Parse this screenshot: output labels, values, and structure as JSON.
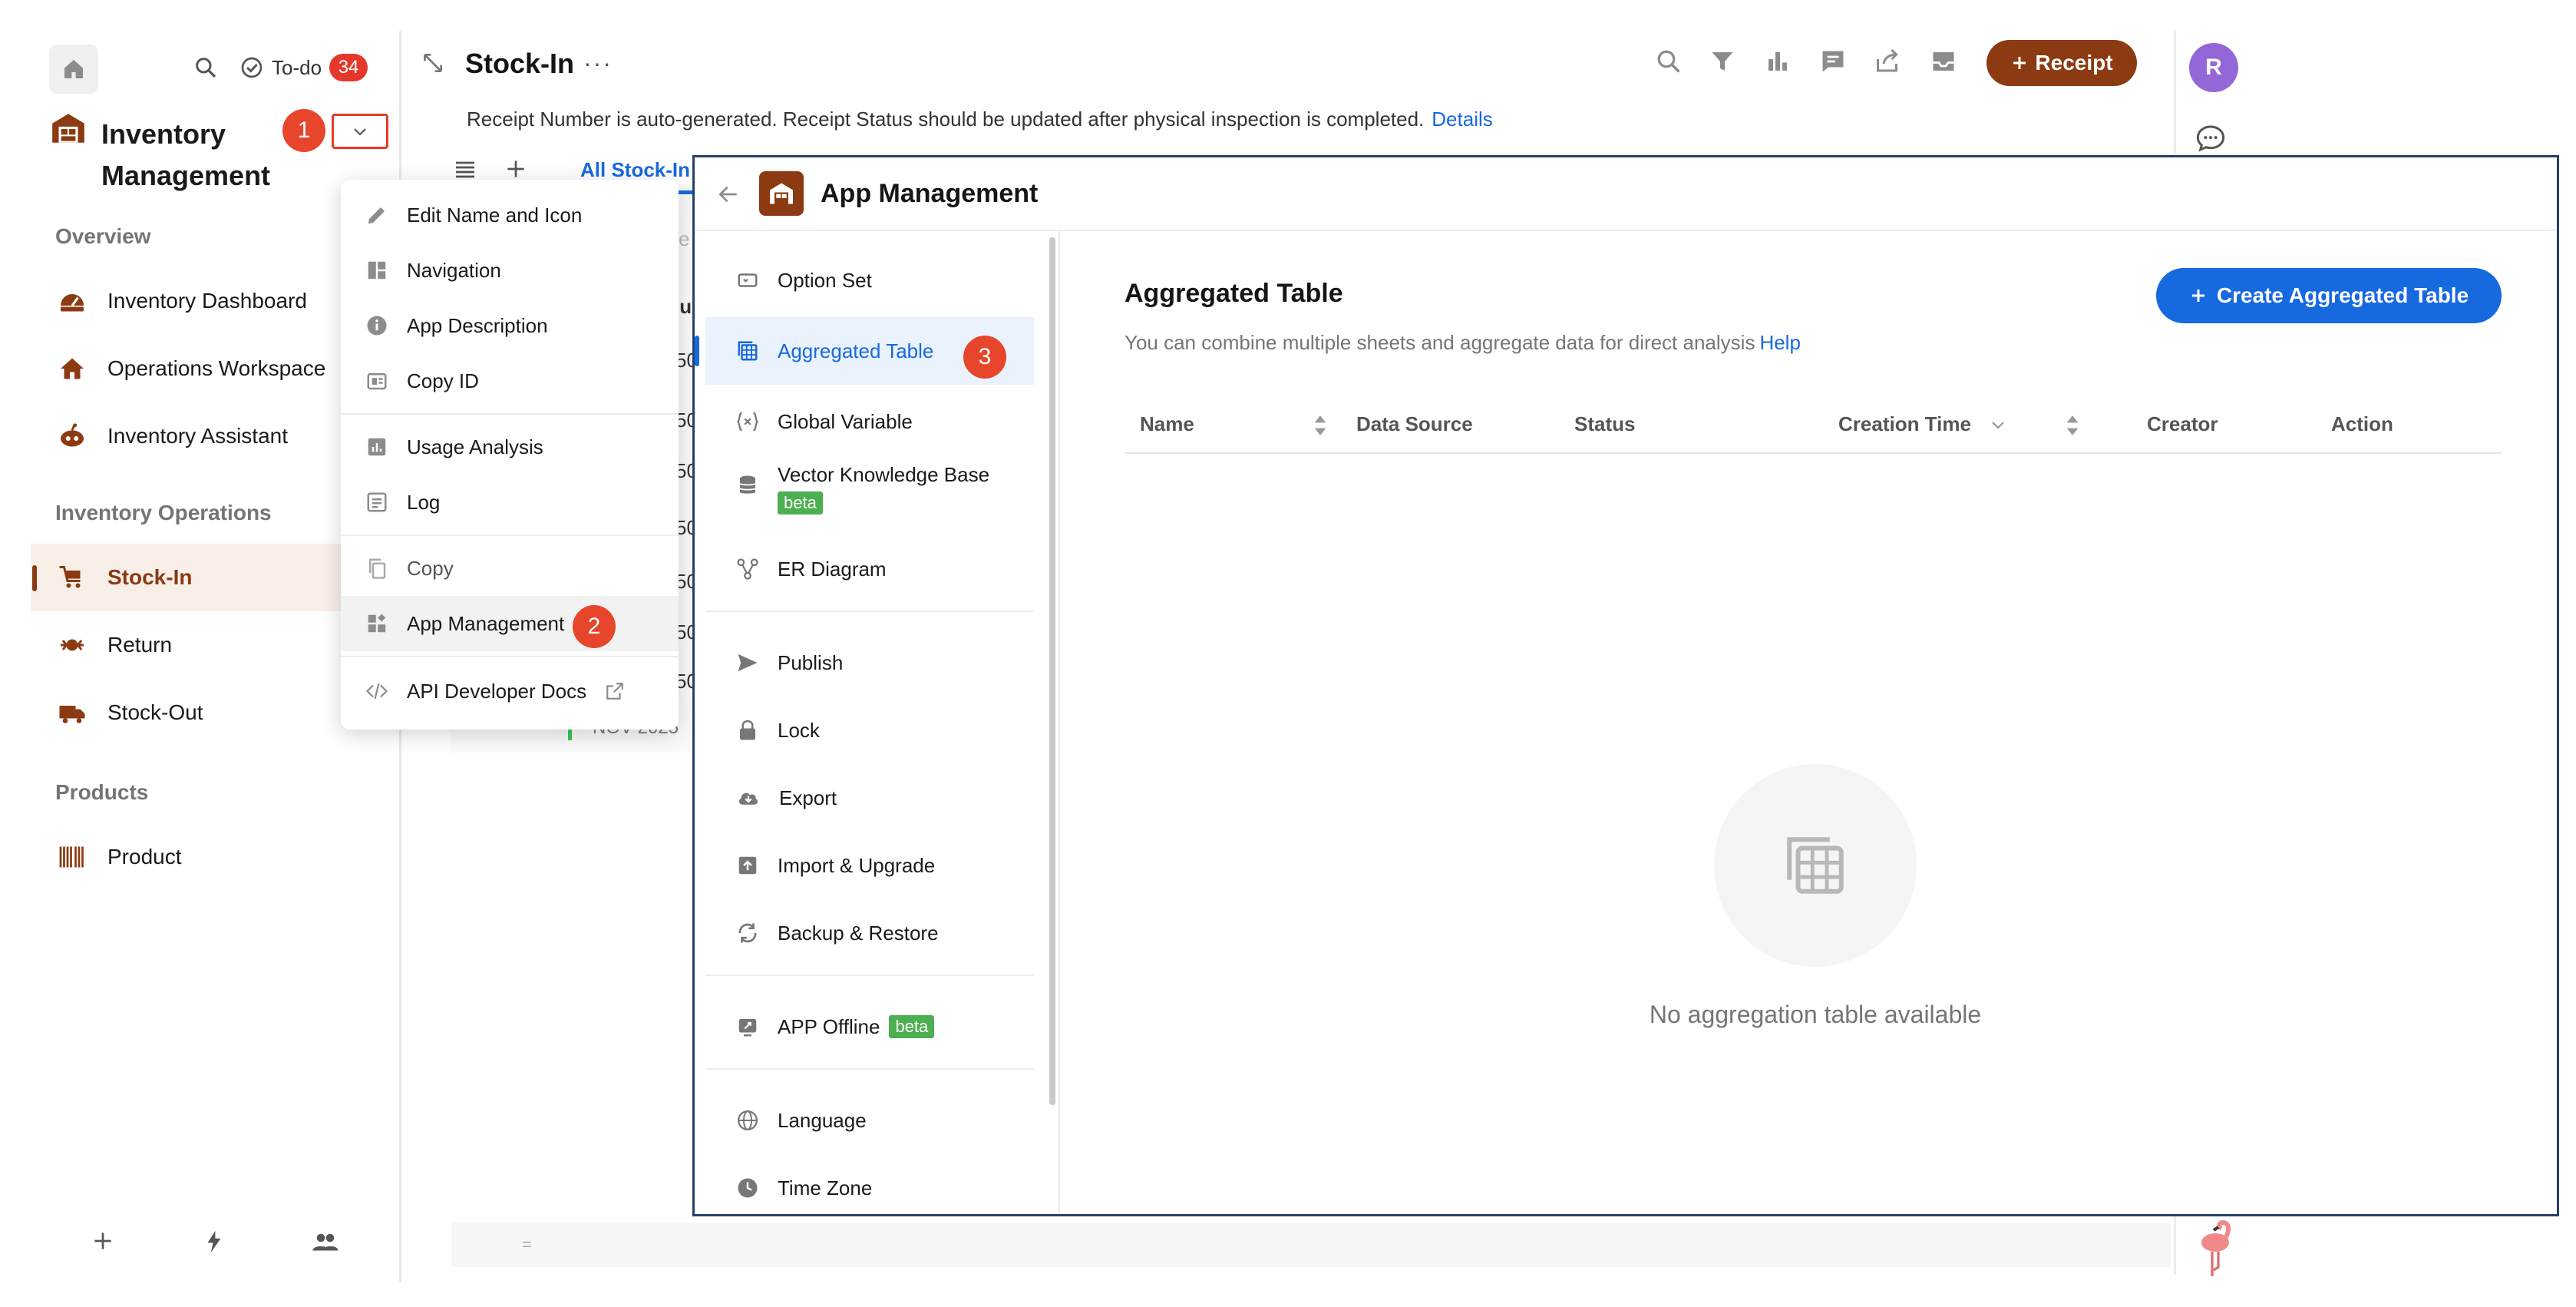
{
  "sidebar": {
    "todo_label": "To-do",
    "todo_count": "34",
    "app_title": "Inventory Management",
    "step1": "1",
    "sections": [
      {
        "label": "Overview"
      },
      {
        "label": "Inventory Operations"
      },
      {
        "label": "Products"
      }
    ],
    "items": [
      {
        "label": "Inventory Dashboard",
        "icon": "dashboard-icon"
      },
      {
        "label": "Operations Workspace",
        "icon": "house-icon"
      },
      {
        "label": "Inventory Assistant",
        "icon": "robot-icon"
      },
      {
        "label": "Stock-In",
        "icon": "cart-icon",
        "active": true
      },
      {
        "label": "Return",
        "icon": "return-icon"
      },
      {
        "label": "Stock-Out",
        "icon": "truck-icon"
      },
      {
        "label": "Product",
        "icon": "barcode-icon"
      }
    ]
  },
  "main": {
    "title": "Stock-In",
    "more": "···",
    "receipt_button": "Receipt",
    "notice": "Receipt Number is auto-generated. Receipt Status should be updated after physical inspection is completed.",
    "notice_link": "Details",
    "tab_label": "All Stock-In",
    "cut_cells": [
      "e",
      "lu",
      "50",
      "50",
      "50",
      "50",
      "50",
      "50",
      "50",
      "NOV 2025"
    ]
  },
  "menu": {
    "items": [
      {
        "label": "Edit Name and Icon",
        "icon": "pencil-icon"
      },
      {
        "label": "Navigation",
        "icon": "layout-icon"
      },
      {
        "label": "App Description",
        "icon": "info-icon"
      },
      {
        "label": "Copy ID",
        "icon": "id-icon"
      },
      {
        "label": "Usage Analysis",
        "icon": "chart-icon"
      },
      {
        "label": "Log",
        "icon": "log-icon"
      },
      {
        "label": "Copy",
        "icon": "copy-icon"
      },
      {
        "label": "App Management",
        "icon": "apps-icon"
      },
      {
        "label": "API Developer Docs",
        "icon": "code-icon"
      }
    ],
    "step2": "2"
  },
  "panel": {
    "title": "App Management",
    "nav": [
      {
        "label": "Option Set"
      },
      {
        "label": "Aggregated Table",
        "active": true
      },
      {
        "label": "Global Variable"
      },
      {
        "label": "Vector Knowledge Base",
        "badge": "beta"
      },
      {
        "label": "ER Diagram"
      },
      {
        "label": "Publish"
      },
      {
        "label": "Lock"
      },
      {
        "label": "Export"
      },
      {
        "label": "Import & Upgrade"
      },
      {
        "label": "Backup & Restore"
      },
      {
        "label": "APP Offline",
        "badge": "beta"
      },
      {
        "label": "Language"
      },
      {
        "label": "Time Zone"
      }
    ],
    "step3": "3",
    "content": {
      "title": "Aggregated Table",
      "description": "You can combine multiple sheets and aggregate data for direct analysis",
      "help_link": "Help",
      "create_button": "Create Aggregated Table",
      "columns": [
        "Name",
        "Data Source",
        "Status",
        "Creation Time",
        "Creator",
        "Action"
      ],
      "empty_text": "No aggregation table available"
    }
  },
  "right": {
    "avatar_initial": "R"
  },
  "colors": {
    "brand": "#8b3a12",
    "accent": "#1769e0",
    "step": "#e8452d",
    "beta": "#4caf50"
  }
}
